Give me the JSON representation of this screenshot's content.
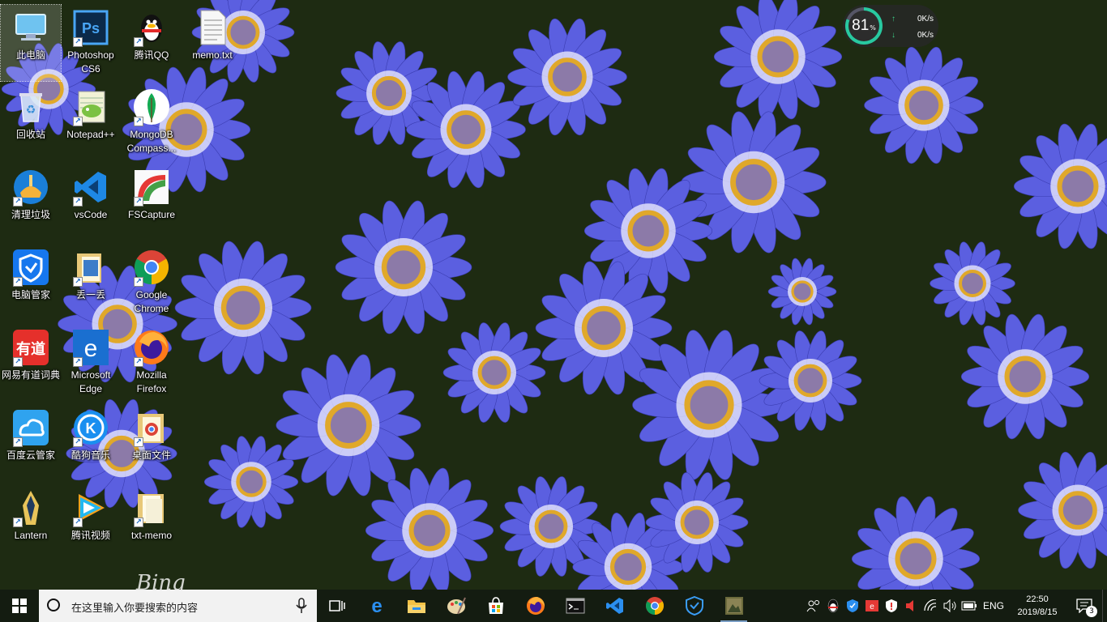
{
  "desktop": {
    "icons": [
      {
        "label": "此电脑",
        "icon": "computer-icon"
      },
      {
        "label": "回收站",
        "icon": "recycle-bin-icon"
      },
      {
        "label": "清理垃圾",
        "icon": "broom-icon"
      },
      {
        "label": "电脑管家",
        "icon": "shield-icon"
      },
      {
        "label": "网易有道词典",
        "icon": "youdao-icon"
      },
      {
        "label": "百度云管家",
        "icon": "baidu-cloud-icon"
      },
      {
        "label": "Lantern",
        "icon": "lantern-icon"
      },
      {
        "label": "Photoshop CS6",
        "icon": "photoshop-icon"
      },
      {
        "label": "Notepad++",
        "icon": "notepadpp-icon"
      },
      {
        "label": "vsCode",
        "icon": "vscode-icon"
      },
      {
        "label": "丢一丢",
        "icon": "folder-icon"
      },
      {
        "label": "Microsoft Edge",
        "icon": "edge-icon"
      },
      {
        "label": "酷狗音乐",
        "icon": "kugou-icon"
      },
      {
        "label": "腾讯视频",
        "icon": "tencent-video-icon"
      },
      {
        "label": "腾讯QQ",
        "icon": "qq-penguin-icon"
      },
      {
        "label": "MongoDB Compass...",
        "icon": "mongodb-leaf-icon"
      },
      {
        "label": "FSCapture",
        "icon": "fscapture-icon"
      },
      {
        "label": "Google Chrome",
        "icon": "chrome-icon"
      },
      {
        "label": "Mozilla Firefox",
        "icon": "firefox-icon"
      },
      {
        "label": "桌面文件",
        "icon": "folder-chrome-icon"
      },
      {
        "label": "txt-memo",
        "icon": "folder-icon"
      },
      {
        "label": "memo.txt",
        "icon": "text-file-icon"
      }
    ],
    "signature": "Bing"
  },
  "net_widget": {
    "cpu_value": "81",
    "cpu_unit": "%",
    "upload": "0K/s",
    "download": "0K/s",
    "cpu_percent": 81
  },
  "taskbar": {
    "search_placeholder": "在这里输入你要搜索的内容",
    "pinned": [
      "task-view-icon",
      "edge-icon",
      "file-explorer-icon",
      "paint-icon",
      "store-icon",
      "firefox-icon",
      "terminal-icon",
      "vscode-icon",
      "chrome-icon",
      "pc-manager-icon",
      "photo-app-icon"
    ],
    "language": "ENG",
    "time": "22:50",
    "date": "2019/8/15",
    "notification_count": "3"
  },
  "colors": {
    "taskbar_bg": "#141c11",
    "search_bg": "#f2f2f2",
    "flower_petal": "#5b5fe0",
    "flower_center": "#e0a82a"
  }
}
